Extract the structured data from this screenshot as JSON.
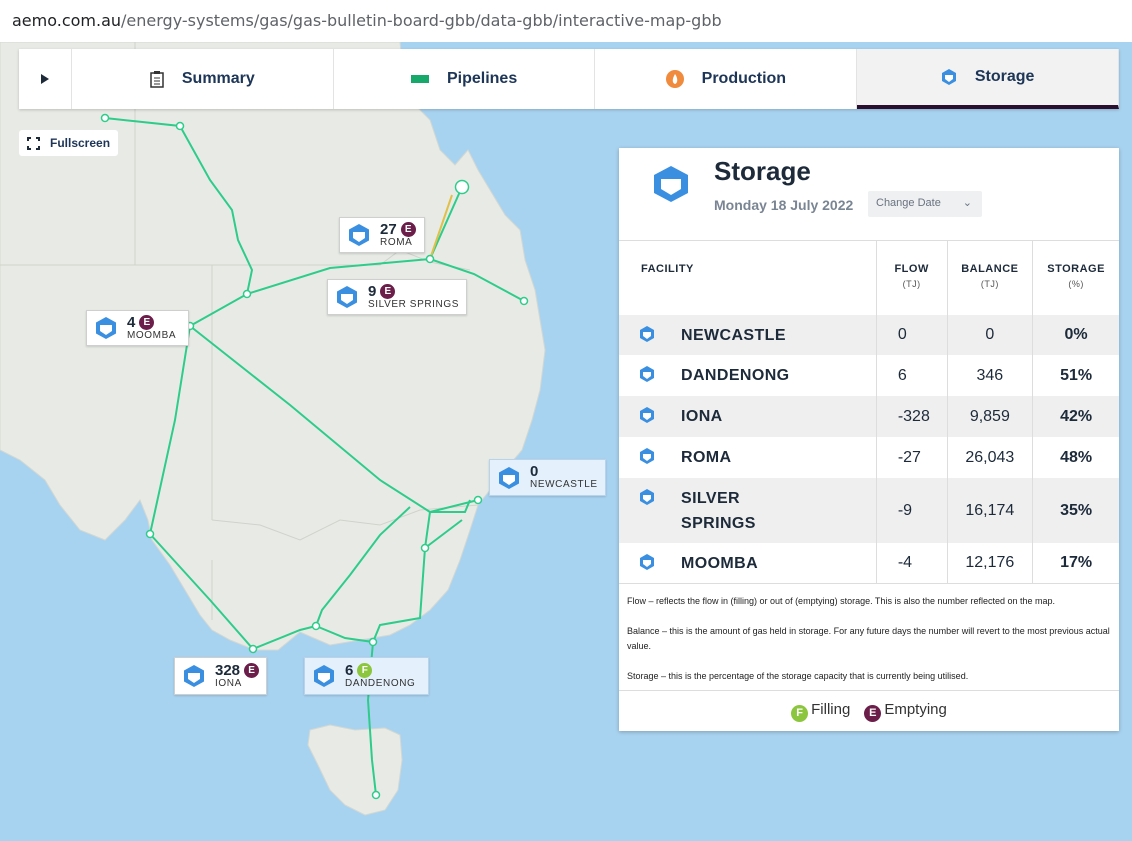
{
  "browser": {
    "url_host": "aemo.com.au",
    "url_path": "/energy-systems/gas/gas-bulletin-board-gbb/data-gbb/interactive-map-gbb"
  },
  "tabs": [
    {
      "label": "Summary",
      "icon": "clipboard-icon"
    },
    {
      "label": "Pipelines",
      "icon": "pipeline-icon"
    },
    {
      "label": "Production",
      "icon": "flame-icon"
    },
    {
      "label": "Storage",
      "icon": "storage-hex-icon",
      "active": true
    }
  ],
  "fullscreen_label": "Fullscreen",
  "map_labels": {
    "roma": {
      "value": "27",
      "name": "ROMA",
      "badge": "E"
    },
    "silver_springs": {
      "value": "9",
      "name": "SILVER SPRINGS",
      "badge": "E"
    },
    "moomba": {
      "value": "4",
      "name": "MOOMBA",
      "badge": "E"
    },
    "newcastle": {
      "value": "0",
      "name": "NEWCASTLE"
    },
    "iona": {
      "value": "328",
      "name": "IONA",
      "badge": "E"
    },
    "dandenong": {
      "value": "6",
      "name": "DANDENONG",
      "badge": "F"
    }
  },
  "panel": {
    "title": "Storage",
    "date": "Monday 18 July 2022",
    "change_date_label": "Change Date",
    "columns": {
      "facility": "FACILITY",
      "flow": "FLOW",
      "flow_unit": "(TJ)",
      "balance": "BALANCE",
      "balance_unit": "(TJ)",
      "storage": "STORAGE",
      "storage_unit": "(%)"
    },
    "rows": [
      {
        "facility": "NEWCASTLE",
        "flow": "0",
        "balance": "0",
        "storage": "0%"
      },
      {
        "facility": "DANDENONG",
        "flow": "6",
        "balance": "346",
        "storage": "51%"
      },
      {
        "facility": "IONA",
        "flow": "-328",
        "balance": "9,859",
        "storage": "42%"
      },
      {
        "facility": "ROMA",
        "flow": "-27",
        "balance": "26,043",
        "storage": "48%"
      },
      {
        "facility": "SILVER SPRINGS",
        "flow": "-9",
        "balance": "16,174",
        "storage": "35%"
      },
      {
        "facility": "MOOMBA",
        "flow": "-4",
        "balance": "12,176",
        "storage": "17%"
      }
    ],
    "notes": [
      "Flow – reflects the flow in (filling) or out of (emptying) storage. This is also the number reflected on the map.",
      "Balance – this is the amount of gas held in storage. For any future days the number will revert to the most previous actual value.",
      "Storage – this is the percentage of the storage capacity that is currently being utilised."
    ],
    "legend": {
      "filling_badge": "F",
      "filling": "Filling",
      "emptying_badge": "E",
      "emptying": "Emptying"
    }
  },
  "colors": {
    "pipeline": "#2ecc8a",
    "ocean": "#a8d3f0",
    "land": "#e8ebe5",
    "storage_blue": "#3b8fe0",
    "emptying": "#6b1e4a",
    "filling": "#8cc63f"
  }
}
